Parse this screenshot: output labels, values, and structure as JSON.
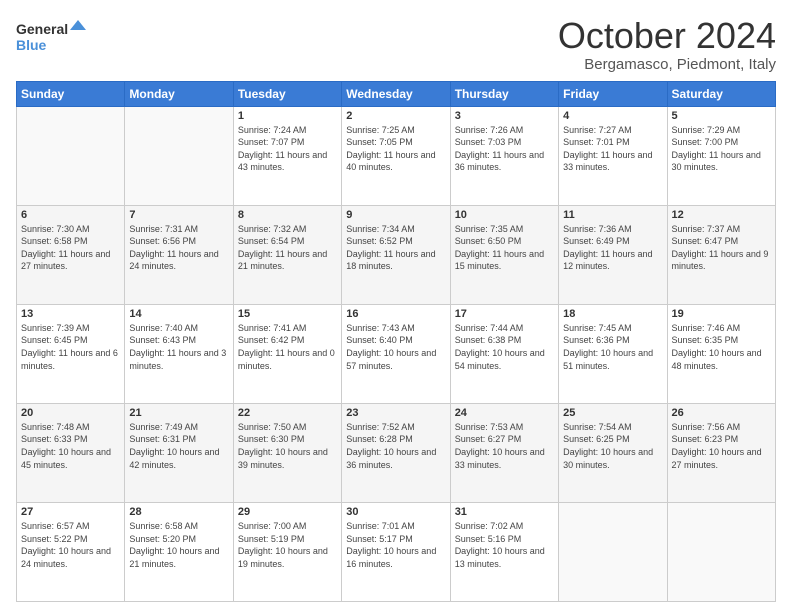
{
  "header": {
    "logo_line1": "General",
    "logo_line2": "Blue",
    "month": "October 2024",
    "location": "Bergamasco, Piedmont, Italy"
  },
  "weekdays": [
    "Sunday",
    "Monday",
    "Tuesday",
    "Wednesday",
    "Thursday",
    "Friday",
    "Saturday"
  ],
  "weeks": [
    [
      {
        "day": "",
        "sunrise": "",
        "sunset": "",
        "daylight": ""
      },
      {
        "day": "",
        "sunrise": "",
        "sunset": "",
        "daylight": ""
      },
      {
        "day": "1",
        "sunrise": "Sunrise: 7:24 AM",
        "sunset": "Sunset: 7:07 PM",
        "daylight": "Daylight: 11 hours and 43 minutes."
      },
      {
        "day": "2",
        "sunrise": "Sunrise: 7:25 AM",
        "sunset": "Sunset: 7:05 PM",
        "daylight": "Daylight: 11 hours and 40 minutes."
      },
      {
        "day": "3",
        "sunrise": "Sunrise: 7:26 AM",
        "sunset": "Sunset: 7:03 PM",
        "daylight": "Daylight: 11 hours and 36 minutes."
      },
      {
        "day": "4",
        "sunrise": "Sunrise: 7:27 AM",
        "sunset": "Sunset: 7:01 PM",
        "daylight": "Daylight: 11 hours and 33 minutes."
      },
      {
        "day": "5",
        "sunrise": "Sunrise: 7:29 AM",
        "sunset": "Sunset: 7:00 PM",
        "daylight": "Daylight: 11 hours and 30 minutes."
      }
    ],
    [
      {
        "day": "6",
        "sunrise": "Sunrise: 7:30 AM",
        "sunset": "Sunset: 6:58 PM",
        "daylight": "Daylight: 11 hours and 27 minutes."
      },
      {
        "day": "7",
        "sunrise": "Sunrise: 7:31 AM",
        "sunset": "Sunset: 6:56 PM",
        "daylight": "Daylight: 11 hours and 24 minutes."
      },
      {
        "day": "8",
        "sunrise": "Sunrise: 7:32 AM",
        "sunset": "Sunset: 6:54 PM",
        "daylight": "Daylight: 11 hours and 21 minutes."
      },
      {
        "day": "9",
        "sunrise": "Sunrise: 7:34 AM",
        "sunset": "Sunset: 6:52 PM",
        "daylight": "Daylight: 11 hours and 18 minutes."
      },
      {
        "day": "10",
        "sunrise": "Sunrise: 7:35 AM",
        "sunset": "Sunset: 6:50 PM",
        "daylight": "Daylight: 11 hours and 15 minutes."
      },
      {
        "day": "11",
        "sunrise": "Sunrise: 7:36 AM",
        "sunset": "Sunset: 6:49 PM",
        "daylight": "Daylight: 11 hours and 12 minutes."
      },
      {
        "day": "12",
        "sunrise": "Sunrise: 7:37 AM",
        "sunset": "Sunset: 6:47 PM",
        "daylight": "Daylight: 11 hours and 9 minutes."
      }
    ],
    [
      {
        "day": "13",
        "sunrise": "Sunrise: 7:39 AM",
        "sunset": "Sunset: 6:45 PM",
        "daylight": "Daylight: 11 hours and 6 minutes."
      },
      {
        "day": "14",
        "sunrise": "Sunrise: 7:40 AM",
        "sunset": "Sunset: 6:43 PM",
        "daylight": "Daylight: 11 hours and 3 minutes."
      },
      {
        "day": "15",
        "sunrise": "Sunrise: 7:41 AM",
        "sunset": "Sunset: 6:42 PM",
        "daylight": "Daylight: 11 hours and 0 minutes."
      },
      {
        "day": "16",
        "sunrise": "Sunrise: 7:43 AM",
        "sunset": "Sunset: 6:40 PM",
        "daylight": "Daylight: 10 hours and 57 minutes."
      },
      {
        "day": "17",
        "sunrise": "Sunrise: 7:44 AM",
        "sunset": "Sunset: 6:38 PM",
        "daylight": "Daylight: 10 hours and 54 minutes."
      },
      {
        "day": "18",
        "sunrise": "Sunrise: 7:45 AM",
        "sunset": "Sunset: 6:36 PM",
        "daylight": "Daylight: 10 hours and 51 minutes."
      },
      {
        "day": "19",
        "sunrise": "Sunrise: 7:46 AM",
        "sunset": "Sunset: 6:35 PM",
        "daylight": "Daylight: 10 hours and 48 minutes."
      }
    ],
    [
      {
        "day": "20",
        "sunrise": "Sunrise: 7:48 AM",
        "sunset": "Sunset: 6:33 PM",
        "daylight": "Daylight: 10 hours and 45 minutes."
      },
      {
        "day": "21",
        "sunrise": "Sunrise: 7:49 AM",
        "sunset": "Sunset: 6:31 PM",
        "daylight": "Daylight: 10 hours and 42 minutes."
      },
      {
        "day": "22",
        "sunrise": "Sunrise: 7:50 AM",
        "sunset": "Sunset: 6:30 PM",
        "daylight": "Daylight: 10 hours and 39 minutes."
      },
      {
        "day": "23",
        "sunrise": "Sunrise: 7:52 AM",
        "sunset": "Sunset: 6:28 PM",
        "daylight": "Daylight: 10 hours and 36 minutes."
      },
      {
        "day": "24",
        "sunrise": "Sunrise: 7:53 AM",
        "sunset": "Sunset: 6:27 PM",
        "daylight": "Daylight: 10 hours and 33 minutes."
      },
      {
        "day": "25",
        "sunrise": "Sunrise: 7:54 AM",
        "sunset": "Sunset: 6:25 PM",
        "daylight": "Daylight: 10 hours and 30 minutes."
      },
      {
        "day": "26",
        "sunrise": "Sunrise: 7:56 AM",
        "sunset": "Sunset: 6:23 PM",
        "daylight": "Daylight: 10 hours and 27 minutes."
      }
    ],
    [
      {
        "day": "27",
        "sunrise": "Sunrise: 6:57 AM",
        "sunset": "Sunset: 5:22 PM",
        "daylight": "Daylight: 10 hours and 24 minutes."
      },
      {
        "day": "28",
        "sunrise": "Sunrise: 6:58 AM",
        "sunset": "Sunset: 5:20 PM",
        "daylight": "Daylight: 10 hours and 21 minutes."
      },
      {
        "day": "29",
        "sunrise": "Sunrise: 7:00 AM",
        "sunset": "Sunset: 5:19 PM",
        "daylight": "Daylight: 10 hours and 19 minutes."
      },
      {
        "day": "30",
        "sunrise": "Sunrise: 7:01 AM",
        "sunset": "Sunset: 5:17 PM",
        "daylight": "Daylight: 10 hours and 16 minutes."
      },
      {
        "day": "31",
        "sunrise": "Sunrise: 7:02 AM",
        "sunset": "Sunset: 5:16 PM",
        "daylight": "Daylight: 10 hours and 13 minutes."
      },
      {
        "day": "",
        "sunrise": "",
        "sunset": "",
        "daylight": ""
      },
      {
        "day": "",
        "sunrise": "",
        "sunset": "",
        "daylight": ""
      }
    ]
  ]
}
